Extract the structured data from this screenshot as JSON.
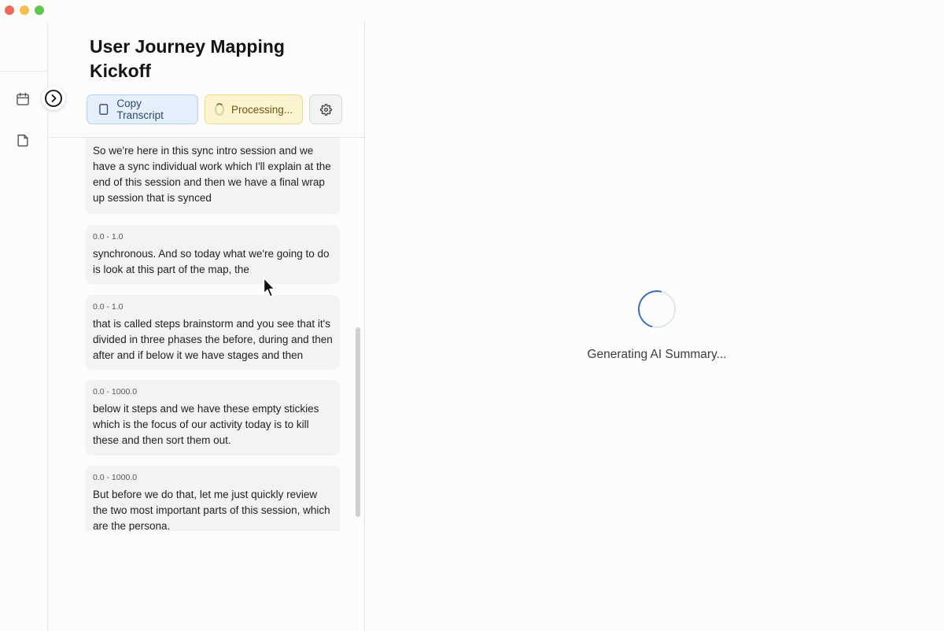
{
  "window": {
    "title": "User Journey Mapping Kickoff"
  },
  "rail": {
    "items": [
      {
        "name": "calendar-icon"
      },
      {
        "name": "document-icon"
      }
    ]
  },
  "toolbar": {
    "copy_label": "Copy Transcript",
    "processing_label": "Processing...",
    "settings_icon": "gear-icon"
  },
  "transcript": {
    "segments": [
      {
        "time": "",
        "text": "So we're here in this sync intro session and we have a sync individual work which I'll explain at the end of this session and then we have a final wrap up session that is synced"
      },
      {
        "time": "0.0 - 1.0",
        "text": "synchronous. And so today what we're going to do is look at this part of the map, the"
      },
      {
        "time": "0.0 - 1.0",
        "text": "that is called steps brainstorm and you see that it's divided in three phases the before, during and then after and if below it we have stages and then"
      },
      {
        "time": "0.0 - 1000.0",
        "text": "below it steps and we have these empty stickies which is the focus of our activity today is to kill these and then sort them out."
      },
      {
        "time": "0.0 - 1000.0",
        "text": "But before we do that, let me just quickly review the two most important parts of this session, which are the persona."
      }
    ]
  },
  "summary": {
    "status_text": "Generating AI Summary..."
  },
  "colors": {
    "accent_blue": "#3a6fc4",
    "processing_yellow": "#fbf4cf",
    "copy_blue": "#e5effb"
  }
}
